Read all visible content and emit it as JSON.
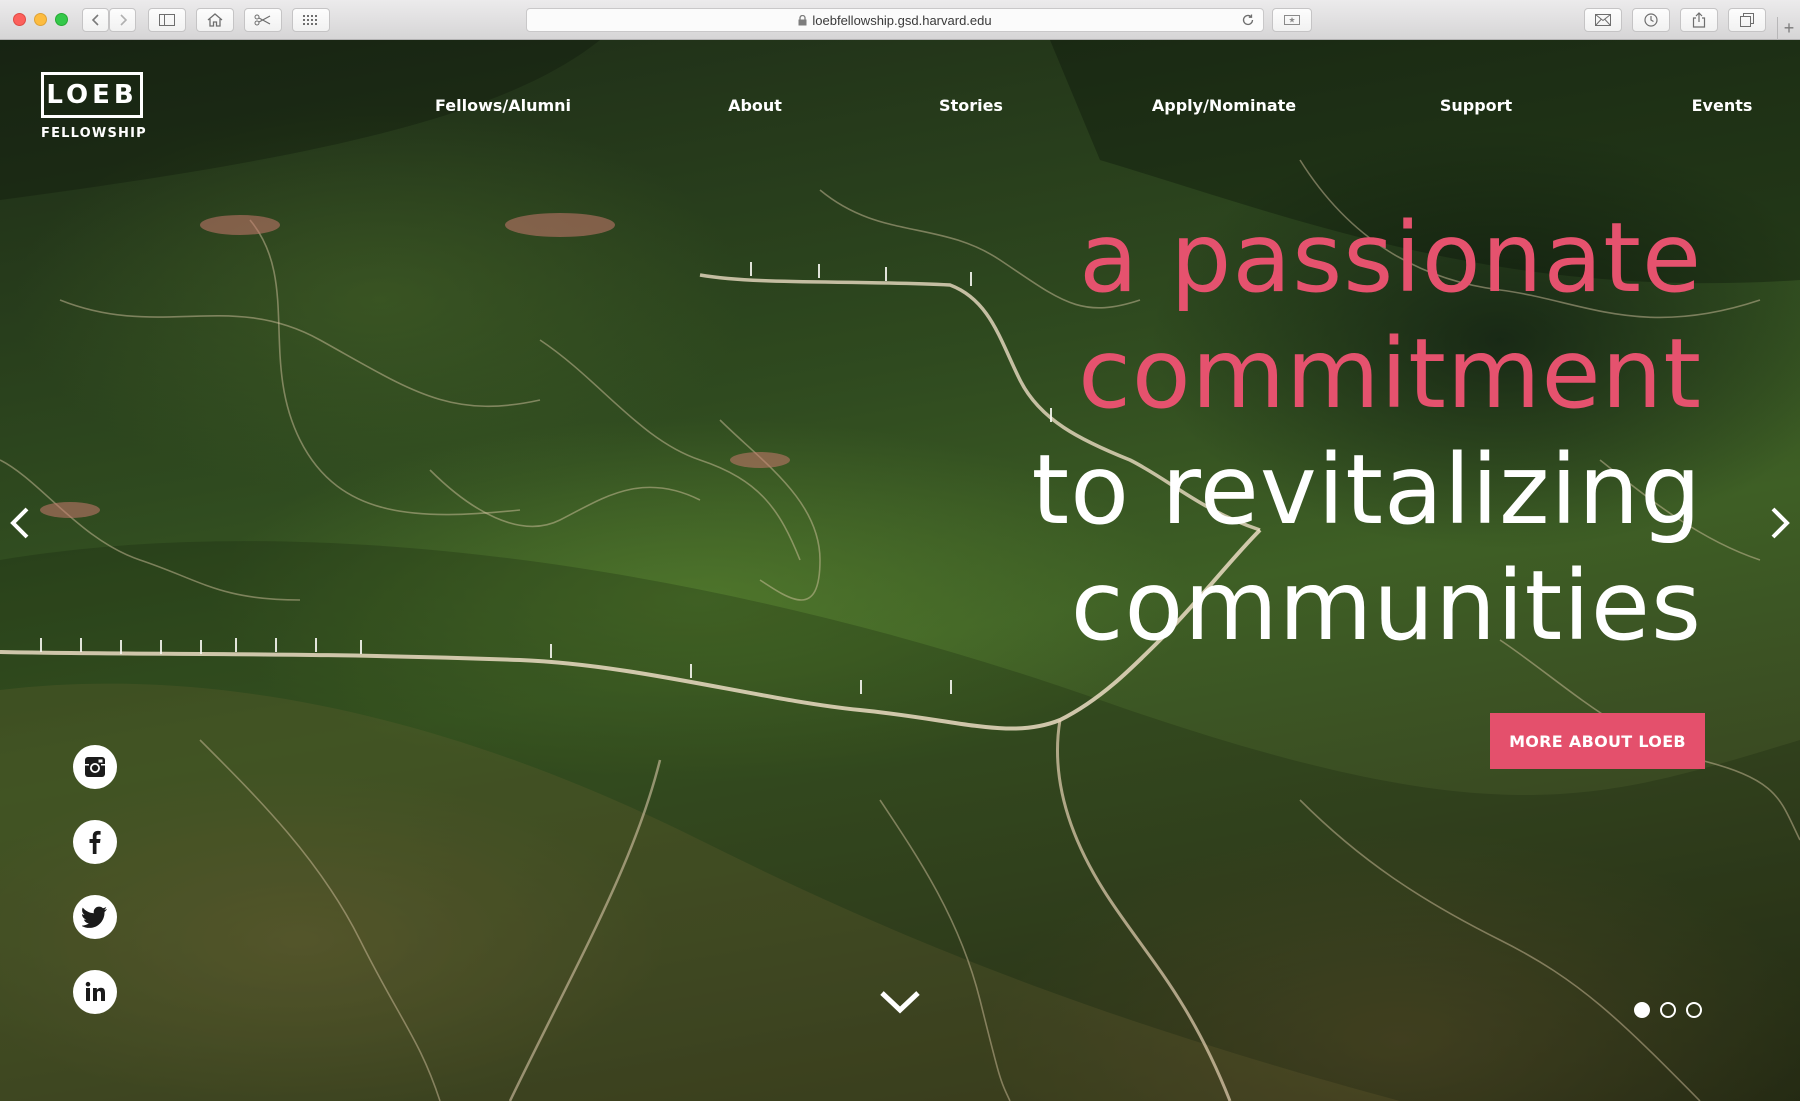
{
  "browser": {
    "url": "loebfellowship.gsd.harvard.edu",
    "new_tab_glyph": "+"
  },
  "icons": {
    "toolbar": [
      "back-icon",
      "forward-icon",
      "sidebar-icon",
      "home-icon",
      "bookmark-scissors-icon",
      "grid-icon",
      "lock-icon",
      "reload-icon",
      "reader-icon",
      "mail-icon",
      "history-icon",
      "share-icon",
      "tabs-icon"
    ],
    "social": [
      "instagram-icon",
      "facebook-icon",
      "twitter-icon",
      "linkedin-icon"
    ]
  },
  "logo": {
    "word": "LOEB",
    "sub": "FELLOWSHIP"
  },
  "nav": {
    "items": [
      {
        "label": "Fellows/Alumni"
      },
      {
        "label": "About"
      },
      {
        "label": "Stories"
      },
      {
        "label": "Apply/Nominate"
      },
      {
        "label": "Support"
      },
      {
        "label": "Events"
      }
    ]
  },
  "hero": {
    "headline": {
      "line1": "a passionate",
      "line2": "commitment",
      "line3": "to revitalizing",
      "line4": "communities"
    },
    "cta_label": "MORE ABOUT LOEB",
    "slides": {
      "count": 3,
      "active": 1
    }
  },
  "colors": {
    "accent": "#e4506c",
    "headline_pink": "#e5526e",
    "text_on_image": "#ffffff"
  }
}
